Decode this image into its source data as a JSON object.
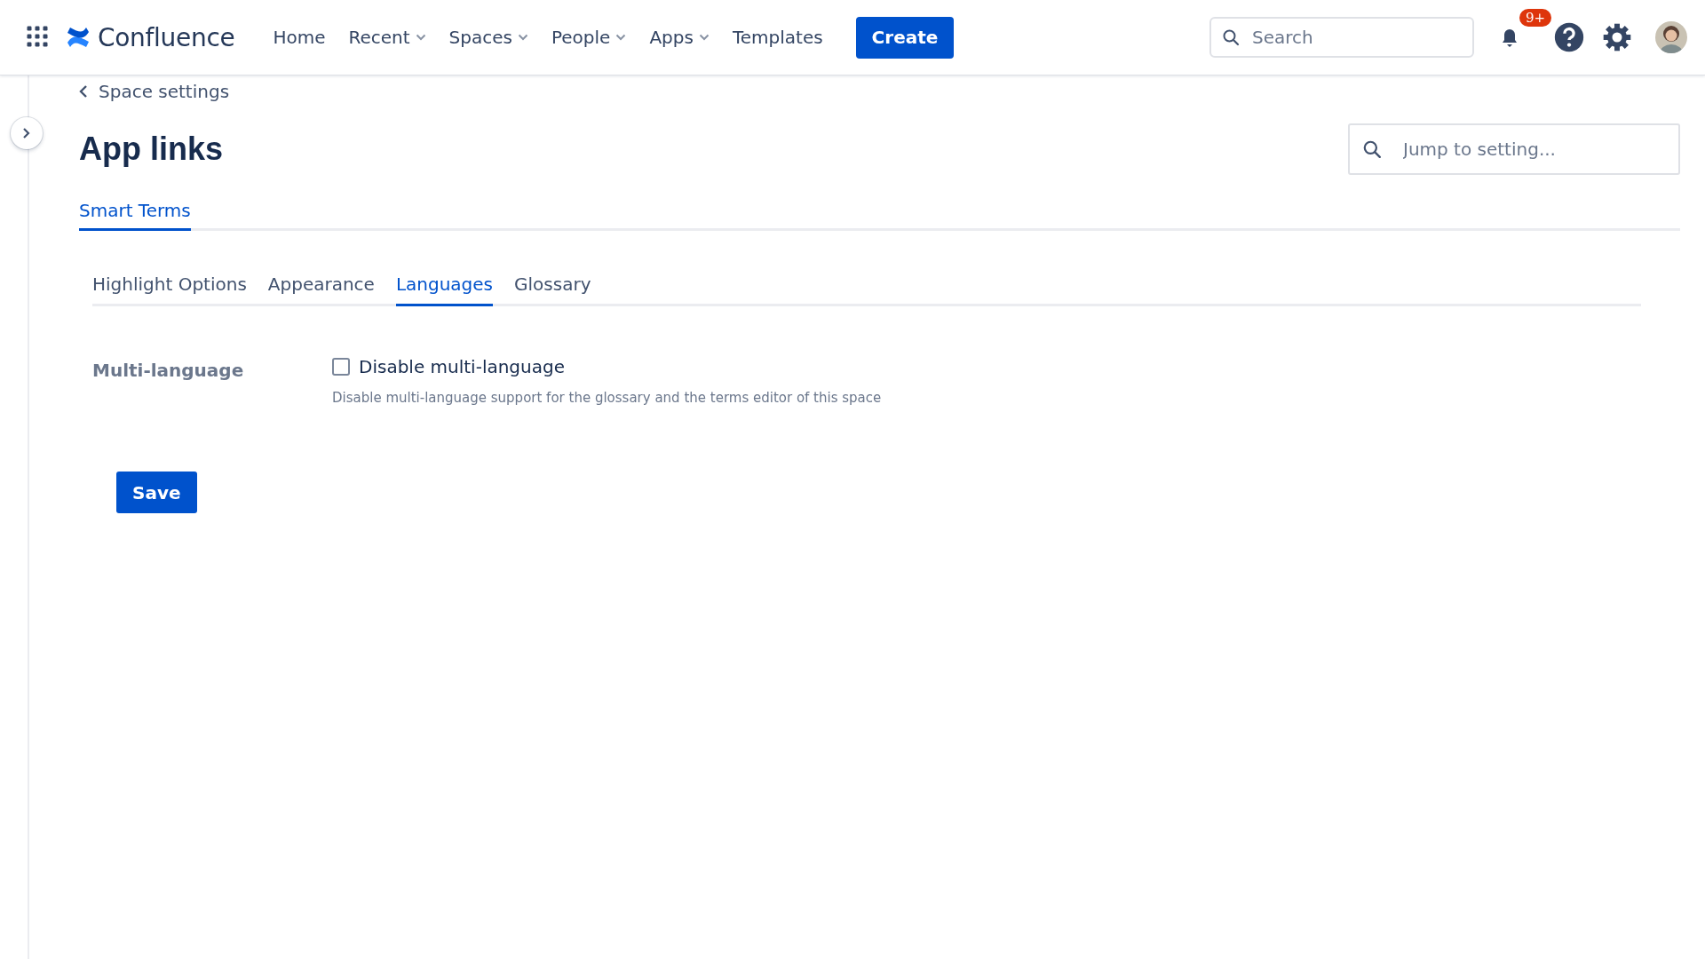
{
  "header": {
    "product": "Confluence",
    "nav": [
      {
        "label": "Home",
        "kind": "link"
      },
      {
        "label": "Recent",
        "kind": "dropdown"
      },
      {
        "label": "Spaces",
        "kind": "dropdown"
      },
      {
        "label": "People",
        "kind": "dropdown"
      },
      {
        "label": "Apps",
        "kind": "dropdown"
      },
      {
        "label": "Templates",
        "kind": "link"
      }
    ],
    "create_button": "Create",
    "search": {
      "placeholder": "Search"
    },
    "notifications_badge": "9+"
  },
  "breadcrumb": "Space settings",
  "page_title": "App links",
  "jump_search": {
    "placeholder": "Jump to setting..."
  },
  "app_tabs": [
    {
      "label": "Smart Terms",
      "selected": true
    }
  ],
  "tabs": [
    {
      "label": "Highlight Options",
      "selected": false
    },
    {
      "label": "Appearance",
      "selected": false
    },
    {
      "label": "Languages",
      "selected": true
    },
    {
      "label": "Glossary",
      "selected": false
    }
  ],
  "settings": [
    {
      "label": "Multi-language",
      "option": "Disable multi-language",
      "checked": false,
      "description": "Disable multi-language support for the glossary and the terms editor of this space"
    }
  ],
  "save_button": "Save"
}
